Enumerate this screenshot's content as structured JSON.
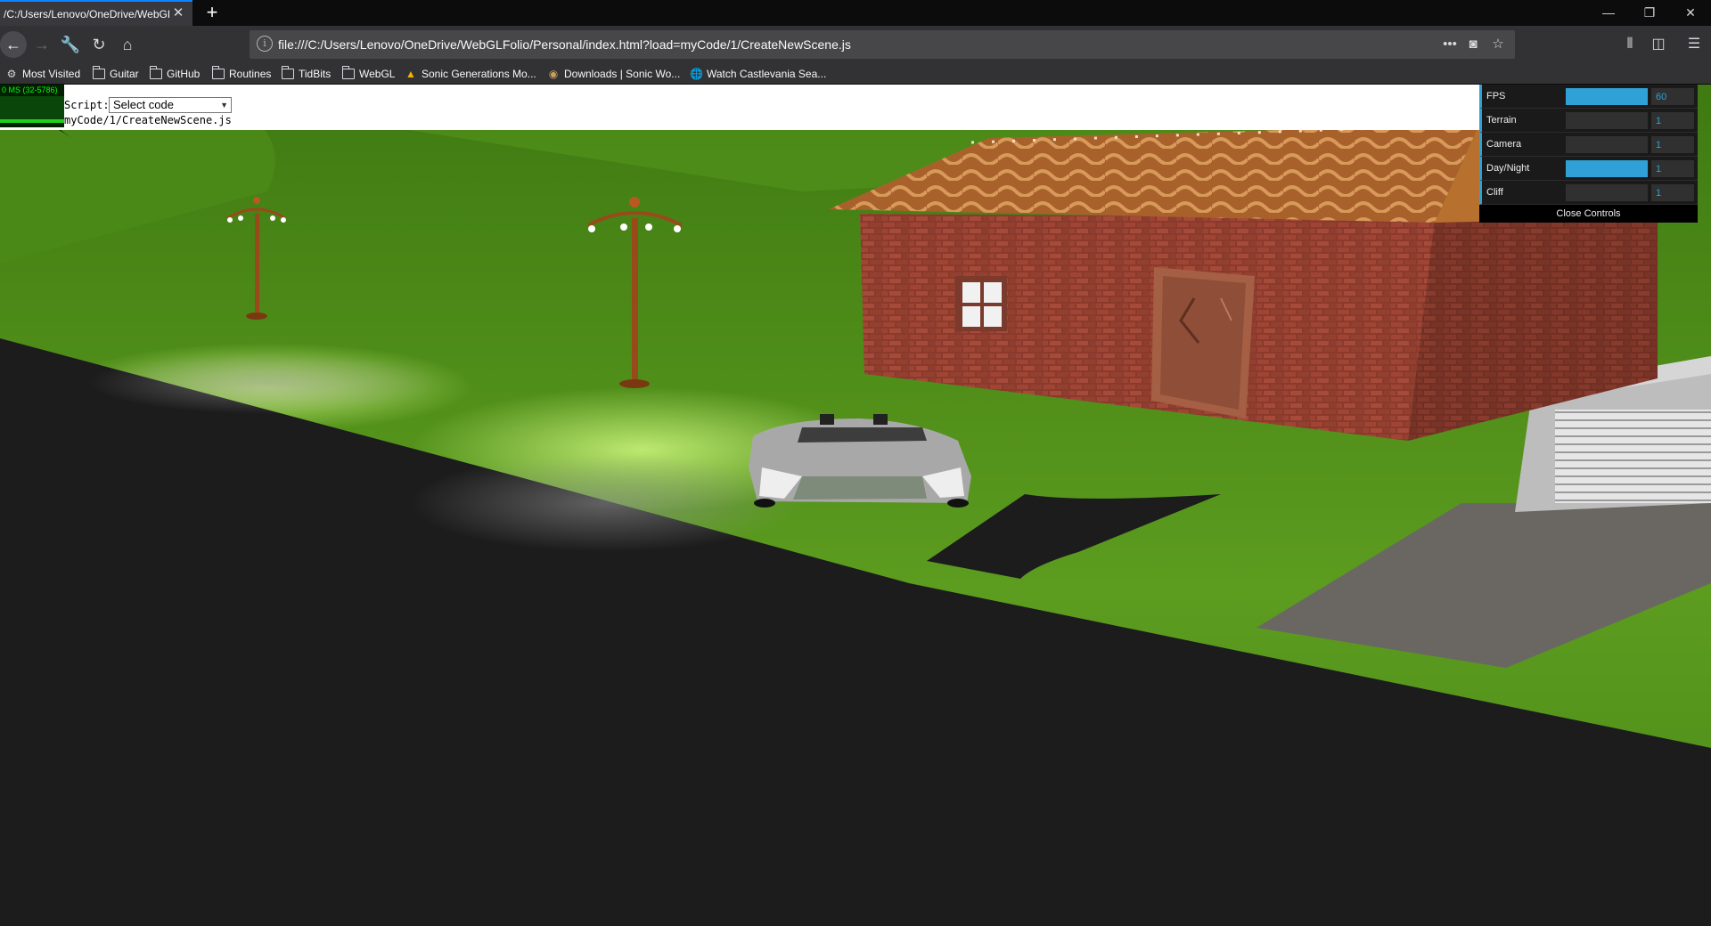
{
  "browser": {
    "tab_title": "/C:/Users/Lenovo/OneDrive/WebGL",
    "url": "file:///C:/Users/Lenovo/OneDrive/WebGLFolio/Personal/index.html?load=myCode/1/CreateNewScene.js",
    "bookmarks": [
      {
        "label": "Most Visited",
        "icon": "gear-icon"
      },
      {
        "label": "Guitar",
        "icon": "folder-icon"
      },
      {
        "label": "GitHub",
        "icon": "folder-icon"
      },
      {
        "label": "Routines",
        "icon": "folder-icon"
      },
      {
        "label": "TidBits",
        "icon": "folder-icon"
      },
      {
        "label": "WebGL",
        "icon": "folder-icon"
      },
      {
        "label": "Sonic Generations Mo...",
        "icon": "drive-icon"
      },
      {
        "label": "Downloads | Sonic Wo...",
        "icon": "site-icon"
      },
      {
        "label": "Watch Castlevania Sea...",
        "icon": "globe-icon"
      }
    ]
  },
  "page": {
    "script_label": "Script:",
    "select_value": "Select code",
    "loaded_path": "myCode/1/CreateNewScene.js",
    "stats_text": "0 MS (32-5786)"
  },
  "gui": {
    "controls": [
      {
        "label": "FPS",
        "value": "60",
        "fill": 1.0
      },
      {
        "label": "Terrain",
        "value": "1",
        "fill": 0.0
      },
      {
        "label": "Camera",
        "value": "1",
        "fill": 0.0
      },
      {
        "label": "Day/Night",
        "value": "1",
        "fill": 1.0
      },
      {
        "label": "Cliff",
        "value": "1",
        "fill": 0.0
      }
    ],
    "close_label": "Close Controls"
  },
  "colors": {
    "accent": "#2fa1d6",
    "grass": "#5a9a1e",
    "road": "#222222",
    "brick": "#8e3d2e",
    "roof": "#b0662e"
  }
}
